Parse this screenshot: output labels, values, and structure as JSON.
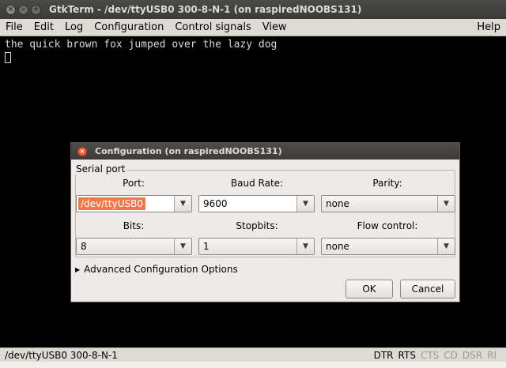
{
  "window": {
    "title": "GtkTerm - /dev/ttyUSB0  300-8-N-1 (on raspiredNOOBS131)"
  },
  "menubar": {
    "items": [
      "File",
      "Edit",
      "Log",
      "Configuration",
      "Control signals",
      "View"
    ],
    "help": "Help"
  },
  "terminal": {
    "line1": "the quick brown fox jumped over the lazy dog"
  },
  "statusbar": {
    "text": "/dev/ttyUSB0  300-8-N-1",
    "signals": [
      {
        "label": "DTR",
        "active": true
      },
      {
        "label": "RTS",
        "active": true
      },
      {
        "label": "CTS",
        "active": false
      },
      {
        "label": "CD",
        "active": false
      },
      {
        "label": "DSR",
        "active": false
      },
      {
        "label": "RI",
        "active": false
      }
    ]
  },
  "dialog": {
    "title": "Configuration (on raspiredNOOBS131)",
    "frame_label": "Serial port",
    "port": {
      "label": "Port:",
      "value": "/dev/ttyUSB0"
    },
    "baud": {
      "label": "Baud Rate:",
      "value": "9600"
    },
    "parity": {
      "label": "Parity:",
      "value": "none"
    },
    "bits": {
      "label": "Bits:",
      "value": "8"
    },
    "stopbits": {
      "label": "Stopbits:",
      "value": "1"
    },
    "flow": {
      "label": "Flow control:",
      "value": "none"
    },
    "advanced": "Advanced Configuration Options",
    "ok": "OK",
    "cancel": "Cancel"
  }
}
